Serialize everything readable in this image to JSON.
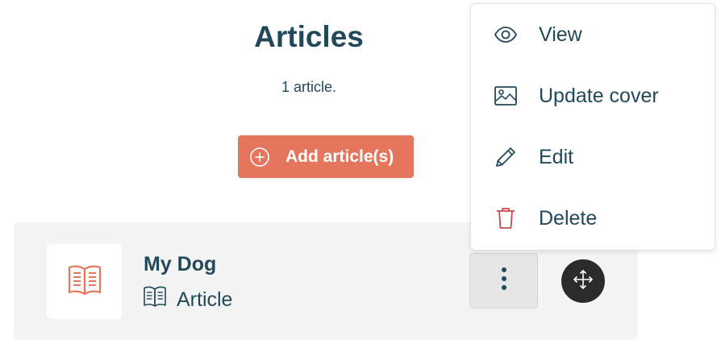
{
  "header": {
    "title": "Articles",
    "count_text": "1 article.",
    "add_button_label": "Add article(s)"
  },
  "articles": [
    {
      "title": "My Dog",
      "type_label": "Article",
      "cover_icon": "open-book-icon",
      "type_icon": "book-icon"
    }
  ],
  "menu": {
    "items": [
      {
        "label": "View",
        "icon": "eye-icon"
      },
      {
        "label": "Update cover",
        "icon": "image-icon"
      },
      {
        "label": "Edit",
        "icon": "pencil-icon"
      },
      {
        "label": "Delete",
        "icon": "trash-icon"
      }
    ]
  },
  "colors": {
    "primary_text": "#22495a",
    "accent": "#e5765e",
    "card_background": "#f4f4f4",
    "delete_icon": "#c94a4a",
    "move_handle": "#2b2b2b"
  }
}
